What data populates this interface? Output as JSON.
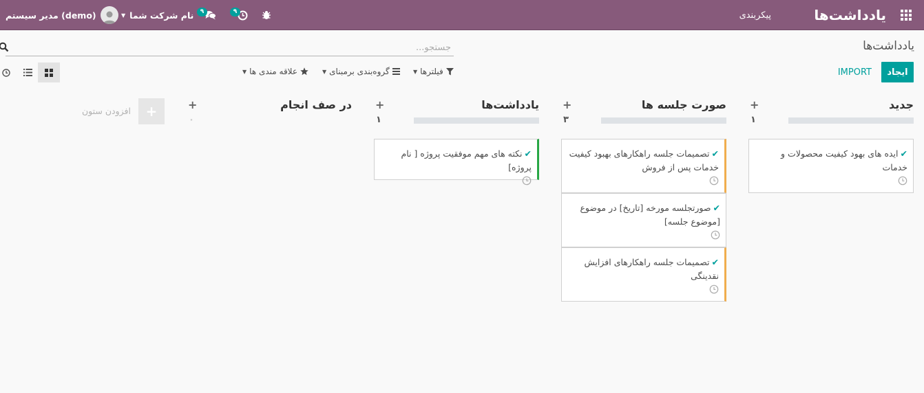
{
  "topbar": {
    "app_title": "یادداشت‌ها",
    "menu": [
      "پیکربندی"
    ],
    "user_name": "مدیر سیستم (demo)",
    "company": "نام شرکت شما",
    "messages_count": "۹",
    "activities_count": "۹",
    "icons": {
      "apps": "grid-icon",
      "messages": "comments-icon",
      "activities": "clock-icon",
      "debug": "bug-icon"
    },
    "color": "#875a7b"
  },
  "control_panel": {
    "breadcrumb": "یادداشت‌ها",
    "search_placeholder": "جستجو...",
    "create_label": "ایجاد",
    "import_label": "IMPORT",
    "filters_label": "فیلترها",
    "groupby_label": "گروه‌بندی برمبنای",
    "favorites_label": "علاقه مندی ها",
    "views": [
      "kanban",
      "list",
      "activity"
    ],
    "active_view": "kanban",
    "accent": "#00a09d"
  },
  "kanban": {
    "columns": [
      {
        "title": "جدید",
        "count": "۱",
        "cards": [
          {
            "text": "ایده های بهود کیفیت محصولات و خدمات",
            "bar": "none"
          }
        ]
      },
      {
        "title": "صورت جلسه ها",
        "count": "۳",
        "cards": [
          {
            "text": "تصمیمات جلسه راهکارهای بهبود کیفیت خدمات پس از فروش",
            "bar": "orange"
          },
          {
            "text": "صورتجلسه مورخه [تاریخ] در موضوع [موضوع جلسه]",
            "bar": "none"
          },
          {
            "text": "تصمیمات جلسه راهکارهای افزایش نقدینگی",
            "bar": "orange"
          }
        ]
      },
      {
        "title": "یادداشت‌ها",
        "count": "۱",
        "cards": [
          {
            "text": "نکته های مهم موفقیت پروژه [ نام پروژه]",
            "bar": "green"
          }
        ]
      },
      {
        "title": "در صف انجام",
        "count": "۰",
        "cards": []
      }
    ],
    "add_column_label": "افزودن ستون"
  }
}
